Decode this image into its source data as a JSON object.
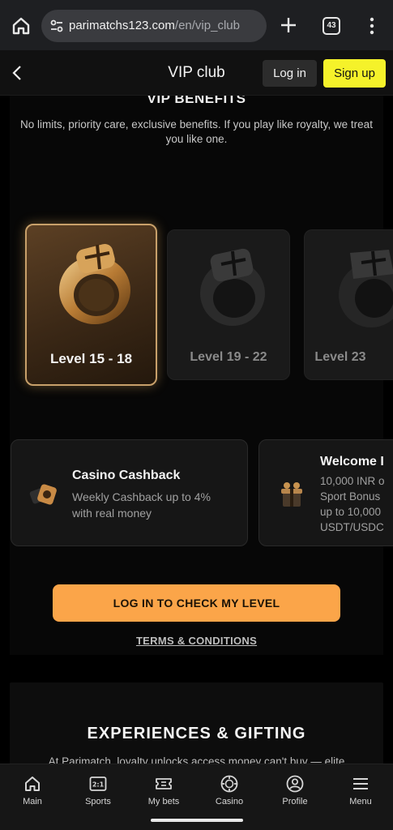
{
  "browser": {
    "url_host": "parimatchs123.com",
    "url_path": "/en/vip_club",
    "tab_count": "43",
    "icons": [
      "home-icon",
      "site-settings-icon",
      "plus-icon",
      "tabs-icon",
      "kebab-menu-icon"
    ]
  },
  "header": {
    "title": "VIP club",
    "login_label": "Log in",
    "signup_label": "Sign up",
    "accent_color": "#f5f22a"
  },
  "benefits": {
    "heading": "VIP BENEFITS",
    "description": "No limits, priority care, exclusive benefits. If you play like royalty, we treat you like one.",
    "levels": [
      {
        "label": "Level 15 - 18",
        "active": true
      },
      {
        "label": "Level 19 - 22",
        "active": false
      },
      {
        "label": "Level 23",
        "active": false
      }
    ],
    "cards": [
      {
        "title": "Casino Cashback",
        "desc_lines": [
          "Weekly Cashback up to 4%",
          "with real money"
        ]
      },
      {
        "title": "Welcome I",
        "desc_lines": [
          "10,000 INR o",
          "Sport Bonus",
          "up to 10,000",
          "USDT/USDC"
        ]
      }
    ]
  },
  "cta": {
    "label": "LOG IN TO CHECK MY LEVEL",
    "color": "#fba549"
  },
  "terms_label": "TERMS & CONDITIONS",
  "experiences": {
    "heading": "EXPERIENCES & GIFTING",
    "description": "At Parimatch, loyalty unlocks access money can't buy — elite"
  },
  "nav": {
    "items": [
      {
        "label": "Main",
        "icon": "home-icon"
      },
      {
        "label": "Sports",
        "icon": "scoreboard-icon"
      },
      {
        "label": "My bets",
        "icon": "ticket-icon"
      },
      {
        "label": "Casino",
        "icon": "casino-chip-icon"
      },
      {
        "label": "Profile",
        "icon": "profile-icon"
      },
      {
        "label": "Menu",
        "icon": "menu-icon"
      }
    ]
  }
}
